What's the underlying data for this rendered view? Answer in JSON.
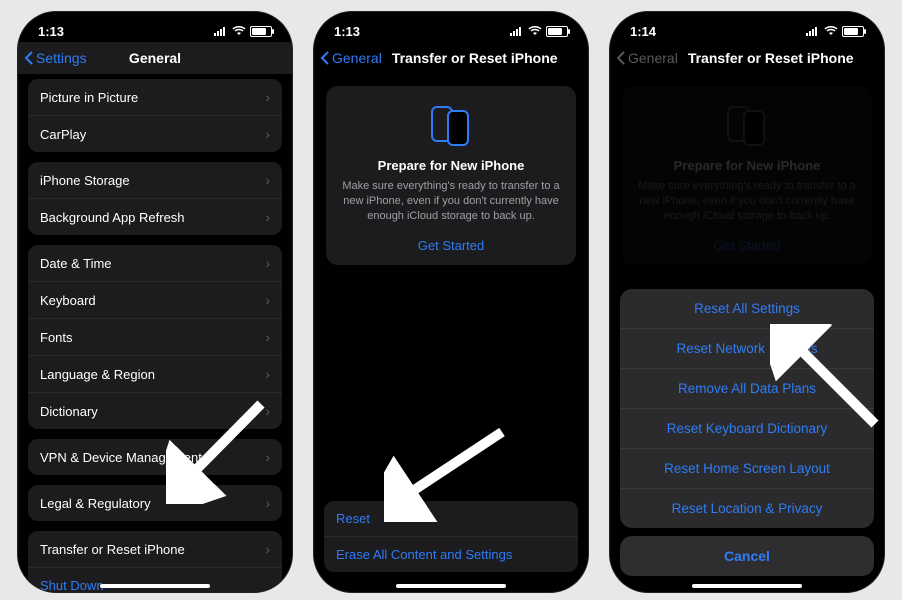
{
  "screens": [
    {
      "status": {
        "time": "1:13"
      },
      "nav": {
        "back": "Settings",
        "title": "General"
      },
      "groups": [
        {
          "rows": [
            {
              "label": "Picture in Picture",
              "chevron": true
            },
            {
              "label": "CarPlay",
              "chevron": true
            }
          ]
        },
        {
          "rows": [
            {
              "label": "iPhone Storage",
              "chevron": true
            },
            {
              "label": "Background App Refresh",
              "chevron": true
            }
          ]
        },
        {
          "rows": [
            {
              "label": "Date & Time",
              "chevron": true
            },
            {
              "label": "Keyboard",
              "chevron": true
            },
            {
              "label": "Fonts",
              "chevron": true
            },
            {
              "label": "Language & Region",
              "chevron": true
            },
            {
              "label": "Dictionary",
              "chevron": true
            }
          ]
        },
        {
          "rows": [
            {
              "label": "VPN & Device Management",
              "chevron": true
            }
          ]
        },
        {
          "rows": [
            {
              "label": "Legal & Regulatory",
              "chevron": true
            }
          ]
        },
        {
          "rows": [
            {
              "label": "Transfer or Reset iPhone",
              "chevron": true
            },
            {
              "label": "Shut Down",
              "link": true
            }
          ]
        }
      ]
    },
    {
      "status": {
        "time": "1:13"
      },
      "nav": {
        "back": "General",
        "title": "Transfer or Reset iPhone"
      },
      "card": {
        "title": "Prepare for New iPhone",
        "text": "Make sure everything's ready to transfer to a new iPhone, even if you don't currently have enough iCloud storage to back up.",
        "cta": "Get Started"
      },
      "bottom": [
        {
          "label": "Reset",
          "link": true
        },
        {
          "label": "Erase All Content and Settings",
          "link": true
        }
      ]
    },
    {
      "status": {
        "time": "1:14"
      },
      "nav": {
        "back": "General",
        "title": "Transfer or Reset iPhone",
        "dim_back": true
      },
      "card": {
        "title": "Prepare for New iPhone",
        "text": "Make sure everything's ready to transfer to a new iPhone, even if you don't currently have enough iCloud storage to back up.",
        "cta": "Get Started"
      },
      "sheet": {
        "options": [
          "Reset All Settings",
          "Reset Network Settings",
          "Remove All Data Plans",
          "Reset Keyboard Dictionary",
          "Reset Home Screen Layout",
          "Reset Location & Privacy"
        ],
        "cancel": "Cancel"
      }
    }
  ]
}
